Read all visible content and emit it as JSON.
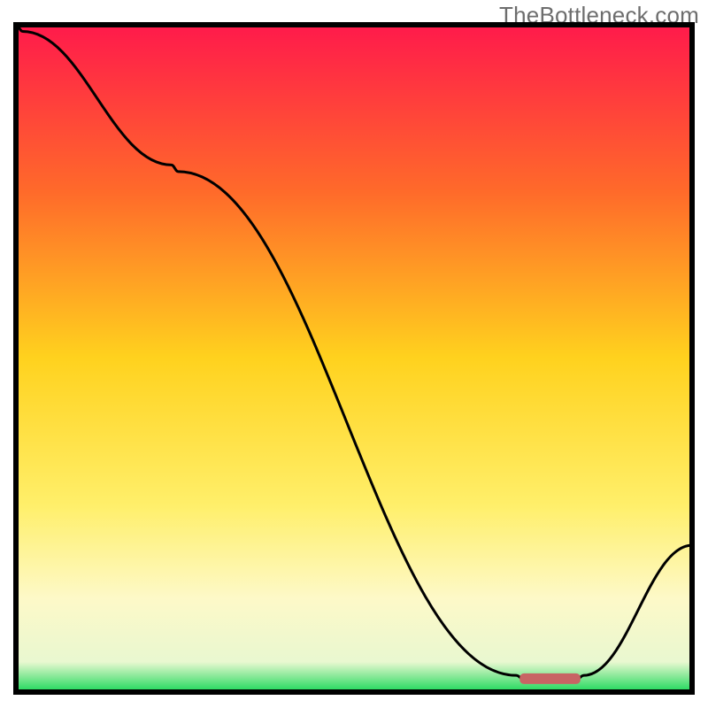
{
  "watermark": "TheBottleneck.com",
  "colors": {
    "frame": "#000000",
    "line": "#000000",
    "marker": "#c86464",
    "gradient_stops": [
      {
        "offset": 0.0,
        "color": "#ff1a4b"
      },
      {
        "offset": 0.25,
        "color": "#ff6a2a"
      },
      {
        "offset": 0.5,
        "color": "#ffd21e"
      },
      {
        "offset": 0.72,
        "color": "#ffef6a"
      },
      {
        "offset": 0.86,
        "color": "#fdf9c8"
      },
      {
        "offset": 0.955,
        "color": "#e9f8d0"
      },
      {
        "offset": 1.0,
        "color": "#1dd85a"
      }
    ]
  },
  "chart_data": {
    "type": "line",
    "title": "",
    "xlabel": "",
    "ylabel": "",
    "xlim": [
      0,
      100
    ],
    "ylim": [
      0,
      100
    ],
    "x": [
      0,
      1,
      23,
      24,
      74,
      75,
      83,
      84,
      100
    ],
    "values": [
      100,
      99,
      79,
      78,
      2.5,
      2,
      2,
      2.5,
      22
    ],
    "marker": {
      "x_range": [
        74.5,
        83.5
      ],
      "y": 2
    }
  }
}
